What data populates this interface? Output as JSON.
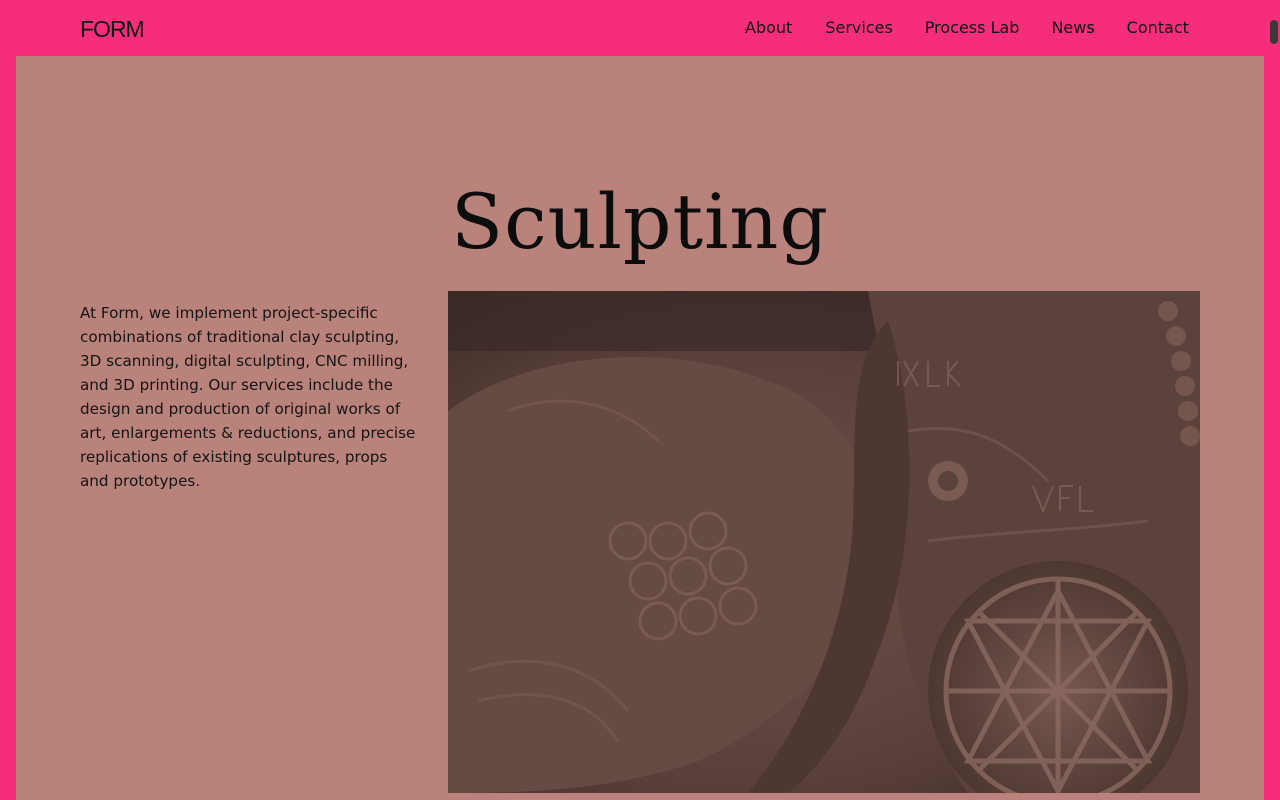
{
  "header": {
    "logo": "FORM",
    "nav": [
      "About",
      "Services",
      "Process Lab",
      "News",
      "Contact"
    ]
  },
  "main": {
    "title": "Sculpting",
    "intro": "At Form, we implement project-specific combinations of traditional clay sculpting, 3D scanning, digital sculpting, CNC milling, and 3D printing. Our services include the design and production of original works of art, enlargements & reductions, and precise replications of existing sculptures, props and prototypes."
  },
  "colors": {
    "background": "#f62d7b",
    "panel": "#b9827b",
    "photo_tint": "#5e443f"
  }
}
